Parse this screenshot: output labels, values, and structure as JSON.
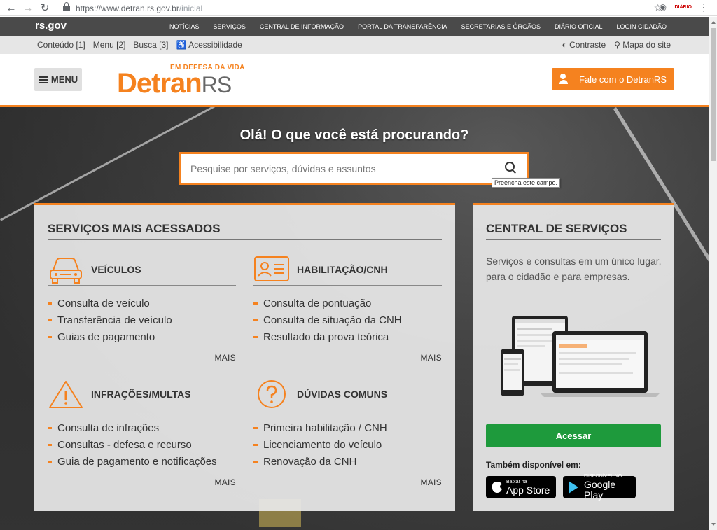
{
  "browser": {
    "url_host": "https://www.detran.rs.gov.br",
    "url_path": "/inicial",
    "icons": {
      "back": "arrow-left-icon",
      "forward": "arrow-right-icon",
      "reload": "reload-icon",
      "star": "star-icon",
      "camera": "camera-icon",
      "extension": "extension-icon",
      "menu": "more-vert-icon"
    },
    "extension_label": "DIÁRIO"
  },
  "topbar": {
    "brand": "rs.gov",
    "links": [
      "NOTÍCIAS",
      "SERVIÇOS",
      "CENTRAL DE INFORMAÇÃO",
      "PORTAL DA TRANSPARÊNCIA",
      "SECRETARIAS E ÓRGÃOS",
      "DIÁRIO OFICIAL",
      "LOGIN CIDADÃO"
    ]
  },
  "accessibility": {
    "left": [
      "Conteúdo [1]",
      "Menu [2]",
      "Busca [3]",
      "Acessibilidade"
    ],
    "contrast": "Contraste",
    "sitemap": "Mapa do site"
  },
  "header": {
    "menu_label": "MENU",
    "logo_tagline": "EM DEFESA DA VIDA",
    "logo_main": "Detran",
    "logo_suffix": "RS",
    "contact_label": "Fale com o DetranRS"
  },
  "hero": {
    "title": "Olá! O que você está procurando?",
    "search_placeholder": "Pesquise por serviços, dúvidas e assuntos",
    "tooltip": "Preencha este campo."
  },
  "services": {
    "title": "SERVIÇOS MAIS ACESSADOS",
    "more_label": "MAIS",
    "groups": [
      {
        "name": "VEÍCULOS",
        "icon": "car-icon",
        "items": [
          "Consulta de veículo",
          "Transferência de veículo",
          "Guias de pagamento"
        ]
      },
      {
        "name": "HABILITAÇÃO/CNH",
        "icon": "id-card-icon",
        "items": [
          "Consulta de pontuação",
          "Consulta de situação da CNH",
          "Resultado da prova teórica"
        ]
      },
      {
        "name": "INFRAÇÕES/MULTAS",
        "icon": "warning-icon",
        "items": [
          "Consulta de infrações",
          "Consultas - defesa e recurso",
          "Guia de pagamento e notificações"
        ]
      },
      {
        "name": "DÚVIDAS COMUNS",
        "icon": "question-icon",
        "items": [
          "Primeira habilitação / CNH",
          "Licenciamento do veículo",
          "Renovação da CNH"
        ]
      }
    ]
  },
  "central": {
    "title": "CENTRAL DE SERVIÇOS",
    "description": "Serviços e consultas em um único lugar, para o cidadão e para empresas.",
    "button_label": "Acessar",
    "also_available": "Também disponível em:",
    "appstore_small": "Baixar na",
    "appstore_big": "App Store",
    "googleplay_small": "DISPONÍVEL NO",
    "googleplay_big": "Google Play"
  },
  "colors": {
    "accent": "#f5821f",
    "success": "#1e9a3c",
    "topbar": "#4a4a4a"
  }
}
